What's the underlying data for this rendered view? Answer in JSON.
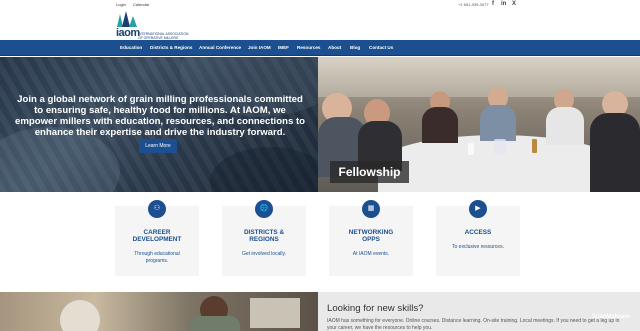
{
  "utility": {
    "login": "Login",
    "calendar": "Calendar",
    "phone": "+1 651-939-3077",
    "social": [
      "f",
      "in",
      "X"
    ]
  },
  "logo": {
    "word": "iaom",
    "tagline": [
      "INTERNATIONAL ASSOCIATION",
      "OF OPERATIVE MILLERS"
    ]
  },
  "nav": {
    "items": [
      "Education",
      "Districts & Regions",
      "Annual Conference",
      "Join IAOM",
      "IMEF",
      "Resources",
      "About",
      "Blog",
      "Contact Us"
    ]
  },
  "hero": {
    "headline": "Join a global network of grain milling professionals committed to ensuring safe, healthy food for millions. At IAOM, we empower millers with education, resources, and connections to enhance their expertise and drive the industry forward.",
    "button": "Learn More",
    "caption": "Fellowship"
  },
  "cards": [
    {
      "icon": "people-icon",
      "title": [
        "CAREER",
        "DEVELOPMENT"
      ],
      "desc": [
        "Through educational",
        "programs."
      ]
    },
    {
      "icon": "globe-icon",
      "title": [
        "DISTRICTS &",
        "REGIONS"
      ],
      "desc": [
        "Get involved locally."
      ]
    },
    {
      "icon": "calendar-icon",
      "title": [
        "NETWORKING",
        "OPPS"
      ],
      "desc": [
        "At IAOM events."
      ]
    },
    {
      "icon": "video-icon",
      "title": [
        "ACCESS"
      ],
      "desc": [
        "To exclusive resources."
      ]
    }
  ],
  "bottom": {
    "heading": "Looking for new skills?",
    "text": "IAOM has something for everyone. Online courses. Distance learning. On-site training. Local meetings. If you need to get a leg up in your career, we have the resources to help you."
  },
  "watermark": "ScanMalware",
  "colors": {
    "brand": "#1b4f8f",
    "nav": "#1b4f8f",
    "card_bg": "#f5f5f5"
  }
}
